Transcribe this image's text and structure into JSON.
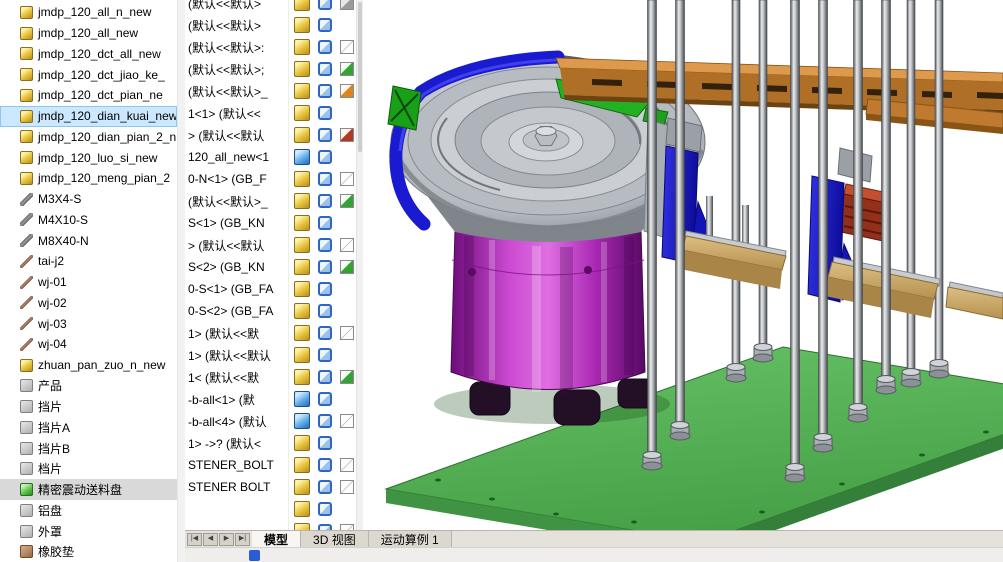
{
  "colors": {
    "selection_blue": "#cce8ff",
    "viewport_bg": "#ffffff",
    "plate_green": "#55b055",
    "plate_green_dark": "#3a8a3c",
    "feeder_purple": "#b832c0",
    "rail_orange_top": "#dd9a4c",
    "rail_orange_front": "#b06f26",
    "mount_blue": "#1a1ad0",
    "bowl_gray": "#c2c6cb",
    "platform_tan": "#d0ad6e"
  },
  "scene": {
    "description": "SolidWorks assembly of a precision vibratory bowl feeder on a green base plate with frame rods, orange linear rail, blue mounts and tan platforms",
    "parts": [
      "base-plate",
      "feeder-base-cylinder",
      "vibratory-bowl",
      "bowl-blue-band",
      "bowl-exit-track",
      "linear-rail",
      "frame-rods",
      "left-mount",
      "right-mount"
    ]
  },
  "left_tree": {
    "items": [
      {
        "label": "jmdp_120_all_n_new",
        "icon": "part",
        "state": null
      },
      {
        "label": "jmdp_120_all_new",
        "icon": "part",
        "state": null
      },
      {
        "label": "jmdp_120_dct_all_new",
        "icon": "part",
        "state": null
      },
      {
        "label": "jmdp_120_dct_jiao_ke_",
        "icon": "part",
        "state": null
      },
      {
        "label": "jmdp_120_dct_pian_ne",
        "icon": "part",
        "state": null
      },
      {
        "label": "jmdp_120_dian_kuai_new",
        "icon": "part",
        "state": "selected-active"
      },
      {
        "label": "jmdp_120_dian_pian_2_n",
        "icon": "part",
        "state": null
      },
      {
        "label": "jmdp_120_luo_si_new",
        "icon": "part",
        "state": null
      },
      {
        "label": "jmdp_120_meng_pian_2",
        "icon": "part",
        "state": null
      },
      {
        "label": "M3X4-S",
        "icon": "screw",
        "state": null
      },
      {
        "label": "M4X10-S",
        "icon": "screw",
        "state": null
      },
      {
        "label": "M8X40-N",
        "icon": "screw",
        "state": null
      },
      {
        "label": "tai-j2",
        "icon": "pin",
        "state": null
      },
      {
        "label": "wj-01",
        "icon": "pin",
        "state": null
      },
      {
        "label": "wj-02",
        "icon": "pin",
        "state": null
      },
      {
        "label": "wj-03",
        "icon": "pin",
        "state": null
      },
      {
        "label": "wj-04",
        "icon": "pin",
        "state": null
      },
      {
        "label": "zhuan_pan_zuo_n_new",
        "icon": "part",
        "state": null
      },
      {
        "label": "产品",
        "icon": "doc",
        "state": null
      },
      {
        "label": "挡片",
        "icon": "doc",
        "state": null
      },
      {
        "label": "挡片A",
        "icon": "doc",
        "state": null
      },
      {
        "label": "挡片B",
        "icon": "doc",
        "state": null
      },
      {
        "label": "档片",
        "icon": "doc",
        "state": null
      },
      {
        "label": "精密震动送料盘",
        "icon": "part-green",
        "state": "selected-inactive"
      },
      {
        "label": "铝盘",
        "icon": "doc",
        "state": null
      },
      {
        "label": "外罩",
        "icon": "doc",
        "state": null
      },
      {
        "label": "橡胶垫",
        "icon": "doc-brown",
        "state": null
      }
    ]
  },
  "feature_tree": {
    "rows": [
      {
        "text": "(默认<<默认>",
        "icon": "part",
        "display": "shaded",
        "swatch": "gray"
      },
      {
        "text": "(默认<<默认>",
        "icon": "part",
        "display": "shaded",
        "swatch": null
      },
      {
        "text": "(默认<<默认>:",
        "icon": "part",
        "display": "shaded",
        "swatch": "white"
      },
      {
        "text": "(默认<<默认>;",
        "icon": "part",
        "display": "shaded",
        "swatch": "green"
      },
      {
        "text": "(默认<<默认>_",
        "icon": "part",
        "display": "shaded",
        "swatch": "orange"
      },
      {
        "text": "1<1> (默认<<",
        "icon": "part",
        "display": "shaded",
        "swatch": null
      },
      {
        "text": "> (默认<<默认",
        "icon": "part",
        "display": "shaded",
        "swatch": "red"
      },
      {
        "text": "120_all_new<1",
        "icon": "assembly",
        "display": "shaded",
        "swatch": null
      },
      {
        "text": "0-N<1> (GB_F",
        "icon": "part",
        "display": "shaded",
        "swatch": "white"
      },
      {
        "text": "(默认<<默认>_",
        "icon": "part",
        "display": "shaded",
        "swatch": "green"
      },
      {
        "text": "S<1> (GB_KN",
        "icon": "part",
        "display": "shaded",
        "swatch": null
      },
      {
        "text": "> (默认<<默认",
        "icon": "part",
        "display": "shaded",
        "swatch": "white"
      },
      {
        "text": "S<2> (GB_KN",
        "icon": "part",
        "display": "shaded",
        "swatch": "green"
      },
      {
        "text": "0-S<1> (GB_FA",
        "icon": "part",
        "display": "shaded",
        "swatch": null
      },
      {
        "text": "0-S<2> (GB_FA",
        "icon": "part",
        "display": "shaded",
        "swatch": null
      },
      {
        "text": "1> (默认<<默",
        "icon": "part",
        "display": "shaded",
        "swatch": "white"
      },
      {
        "text": "1> (默认<<默认",
        "icon": "part",
        "display": "shaded",
        "swatch": null
      },
      {
        "text": "1< (默认<<默",
        "icon": "part",
        "display": "shaded",
        "swatch": "green"
      },
      {
        "text": "-b-all<1> (默",
        "icon": "assembly",
        "display": "shaded",
        "swatch": null
      },
      {
        "text": "-b-all<4> (默认",
        "icon": "assembly",
        "display": "shaded",
        "swatch": "white"
      },
      {
        "text": "1> ->? (默认<",
        "icon": "part",
        "display": "shaded",
        "swatch": null
      },
      {
        "text": "STENER_BOLT",
        "icon": "part",
        "display": "shaded",
        "swatch": "white"
      },
      {
        "text": "STENER BOLT",
        "icon": "part",
        "display": "shaded",
        "swatch": "white"
      },
      {
        "text": "",
        "icon": "part",
        "display": "shaded",
        "swatch": null
      },
      {
        "text": "",
        "icon": "part",
        "display": "shaded",
        "swatch": "white"
      }
    ]
  },
  "bottom_bar": {
    "nav": [
      {
        "label": "|◀"
      },
      {
        "label": "◀"
      },
      {
        "label": "▶"
      },
      {
        "label": "▶|"
      }
    ],
    "tabs": [
      {
        "label": "模型",
        "state": "active"
      },
      {
        "label": "3D 视图",
        "state": null
      },
      {
        "label": "运动算例 1",
        "state": null
      }
    ]
  }
}
